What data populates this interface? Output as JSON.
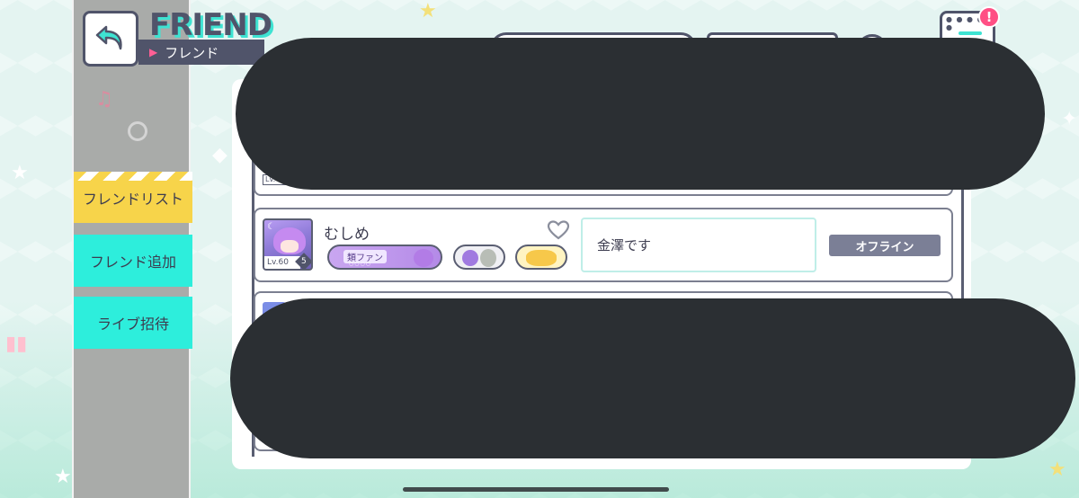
{
  "header": {
    "title_en": "FRIEND",
    "title_jp": "フレンド",
    "notification_count": "!"
  },
  "sidebar": {
    "items": [
      {
        "label": "フレンドリスト",
        "active": true
      },
      {
        "label": "フレンド追加",
        "active": false
      },
      {
        "label": "ライブ招待",
        "active": false
      }
    ]
  },
  "friend": {
    "name": "むしめ",
    "level": "Lv.60",
    "rank": "5",
    "fan_badge": "類ファン",
    "comment": "金澤です",
    "status": "オフライン"
  },
  "peek": {
    "level_top": "Lv."
  },
  "colors": {
    "accent": "#2deedc",
    "active_tab": "#f7d44a",
    "dark": "#50546a",
    "badge": "#ff4f84",
    "status": "#7b7f96",
    "redaction": "#2b2f33"
  },
  "icons": {
    "back": "back-arrow-icon",
    "menu": "hamburger-menu-icon",
    "heart": "heart-outline-icon"
  }
}
